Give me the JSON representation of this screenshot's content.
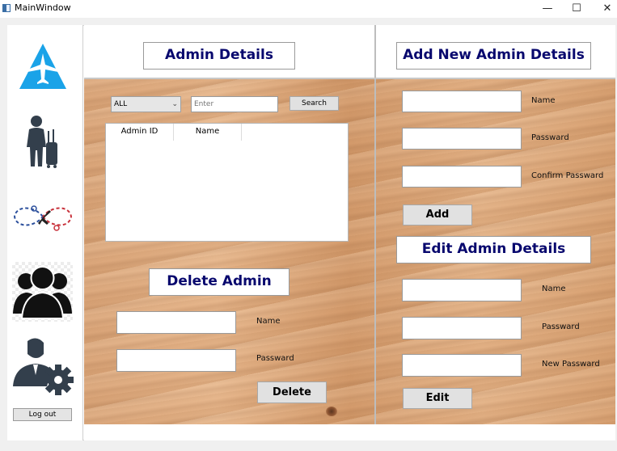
{
  "window": {
    "title": "MainWindow",
    "minimize": "—",
    "maximize": "☐",
    "close": "✕"
  },
  "sidebar": {
    "items": [
      {
        "icon": "airline-logo-icon"
      },
      {
        "icon": "traveler-icon"
      },
      {
        "icon": "flight-route-icon"
      },
      {
        "icon": "users-group-icon"
      },
      {
        "icon": "admin-settings-icon"
      }
    ],
    "logout_label": "Log out"
  },
  "admin_details": {
    "title": "Admin Details",
    "filter_selected": "ALL",
    "search_placeholder": "Enter",
    "search_label": "Search",
    "table_headers": [
      "Admin ID",
      "Name"
    ],
    "table_rows": []
  },
  "delete_admin": {
    "title": "Delete Admin",
    "name_label": "Name",
    "password_label": "Passward",
    "delete_label": "Delete"
  },
  "add_admin": {
    "title": "Add New Admin Details",
    "name_label": "Name",
    "password_label": "Passward",
    "confirm_label": "Confirm Passward",
    "add_label": "Add"
  },
  "edit_admin": {
    "title": "Edit Admin Details",
    "name_label": "Name",
    "password_label": "Passward",
    "new_password_label": "New Passward",
    "edit_label": "Edit"
  },
  "colors": {
    "heading_text": "#08086e",
    "sidebar_icon": "#333f4c",
    "logo_blue": "#1aa3e8"
  }
}
